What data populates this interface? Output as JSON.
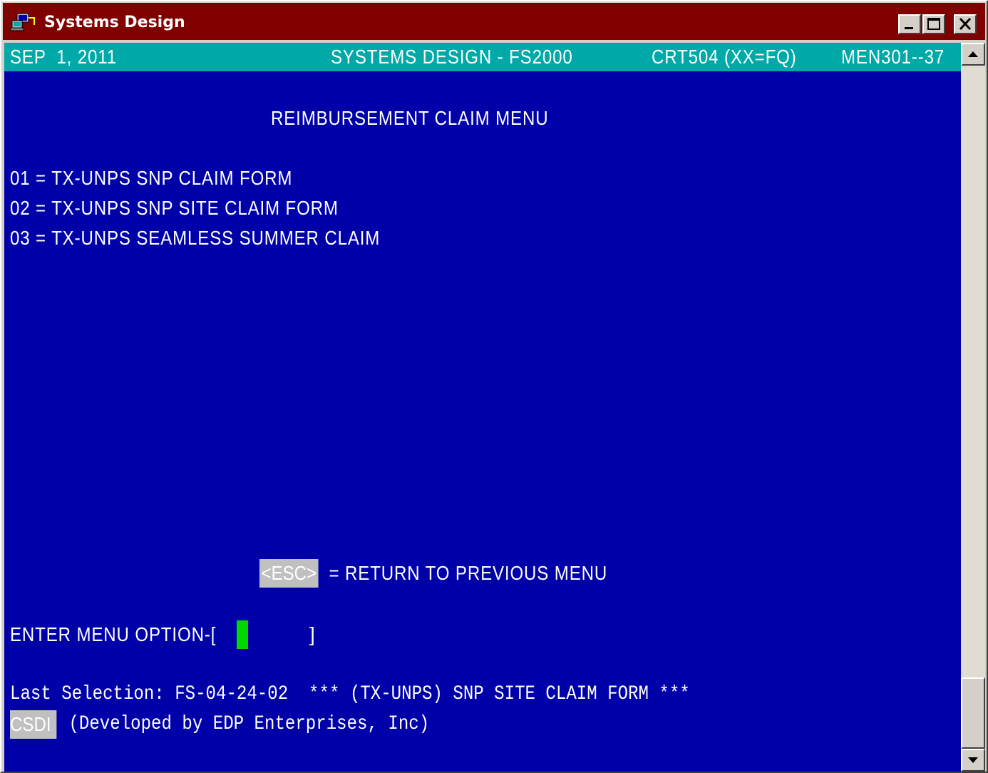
{
  "window": {
    "title": "Systems Design",
    "icon": "network-computer-icon",
    "controls": [
      "minimize-icon",
      "maximize-icon",
      "close-icon"
    ]
  },
  "status": {
    "date": "SEP  1, 2011",
    "system": "SYSTEMS DESIGN - FS2000",
    "terminal": "CRT504 (XX=FQ)",
    "menu_code": "MEN301--37"
  },
  "screen": {
    "heading": "REIMBURSEMENT CLAIM MENU",
    "options": [
      {
        "label": "01 = TX-UNPS SNP CLAIM FORM"
      },
      {
        "label": "02 = TX-UNPS SNP SITE CLAIM FORM"
      },
      {
        "label": "03 = TX-UNPS SEAMLESS SUMMER CLAIM"
      }
    ],
    "esc_key": "<ESC>",
    "esc_text": " = RETURN TO PREVIOUS MENU",
    "prompt_label": "ENTER MENU OPTION-[",
    "prompt_close": "]",
    "prompt_value": "",
    "last_selection": "Last Selection: FS-04-24-02  *** (TX-UNPS) SNP SITE CLAIM FORM ***",
    "footer_tag": "CSDI",
    "footer_text": " (Developed by EDP Enterprises, Inc)"
  },
  "colors": {
    "title_bar": "#800000",
    "screen_bg": "#0000a8",
    "status_bar": "#00a8a8",
    "cursor": "#00d800",
    "highlight": "#c0c0c0"
  }
}
